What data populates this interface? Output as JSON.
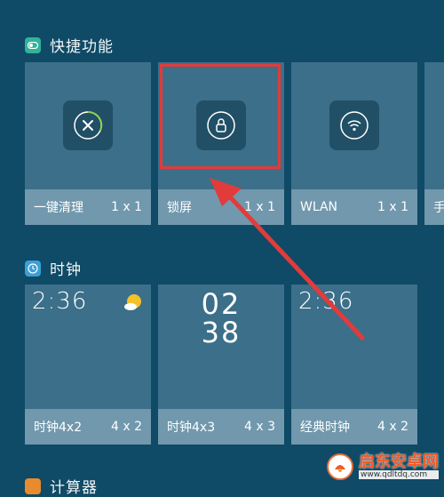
{
  "sections": {
    "shortcuts": {
      "title": "快捷功能",
      "icon": "toggle-icon",
      "color": "#31b39a"
    },
    "clock": {
      "title": "时钟",
      "icon": "clock-icon",
      "color": "#3a9fd8"
    },
    "calculator": {
      "title": "计算器",
      "icon": "calculator-icon",
      "color": "#e88a2e"
    }
  },
  "shortcut_tiles": [
    {
      "name": "一键清理",
      "size": "1 x 1",
      "icon": "cleanup-icon"
    },
    {
      "name": "锁屏",
      "size": "1 x 1",
      "icon": "lock-icon"
    },
    {
      "name": "WLAN",
      "size": "1 x 1",
      "icon": "wifi-icon"
    },
    {
      "name": "手",
      "size": "",
      "icon": ""
    }
  ],
  "clock_tiles": [
    {
      "name": "时钟4x2",
      "size": "4 x 2",
      "time": "2:36",
      "icon": "weather-sun-icon"
    },
    {
      "name": "时钟4x3",
      "size": "4 x 3",
      "hour": "02",
      "minute": "38"
    },
    {
      "name": "经典时钟",
      "size": "4 x 2",
      "time": "2:36"
    }
  ],
  "watermark": {
    "text": "启东安卓网",
    "url": "www.qdltdq.com"
  },
  "colors": {
    "background": "#0f4a66",
    "highlight": "#e23b3b",
    "arrow": "#e23b3b"
  }
}
